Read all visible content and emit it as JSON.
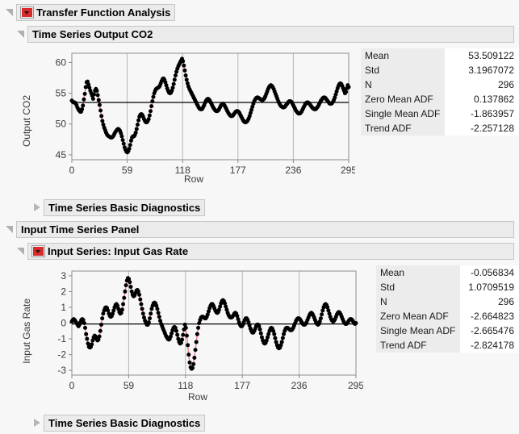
{
  "sections": {
    "root": {
      "title": "Transfer Function Analysis",
      "state": "expanded",
      "has_menu": true
    },
    "output_series": {
      "title": "Time Series Output CO2",
      "state": "expanded",
      "has_menu": false
    },
    "output_diagnostics": {
      "title": "Time Series Basic Diagnostics",
      "state": "collapsed",
      "has_menu": false
    },
    "input_panel": {
      "title": "Input Time Series Panel",
      "state": "expanded",
      "has_menu": false
    },
    "input_series": {
      "title": "Input Series: Input Gas Rate",
      "state": "expanded",
      "has_menu": true
    },
    "input_diagnostics": {
      "title": "Time Series Basic Diagnostics",
      "state": "collapsed",
      "has_menu": false
    }
  },
  "icons": {
    "open_triangle": "disclosure-open-triangle",
    "closed_triangle": "disclosure-closed-triangle",
    "red_menu": "red-triangle-menu-button"
  },
  "colors": {
    "marker": "#000000",
    "connector": "#f4808a",
    "mean_line": "#000000",
    "grid": "#b4b4b4",
    "frame": "#8c8c8c",
    "header_bg": "#ebebeb",
    "stats_key_bg": "#ececec",
    "red_button": "#d92b2b"
  },
  "stats_headers": [
    "Mean",
    "Std",
    "N",
    "Zero Mean ADF",
    "Single Mean ADF",
    "Trend ADF"
  ],
  "output_stats": [
    {
      "label": "Mean",
      "value": "53.509122"
    },
    {
      "label": "Std",
      "value": "3.1967072"
    },
    {
      "label": "N",
      "value": "296"
    },
    {
      "label": "Zero Mean ADF",
      "value": "0.137862"
    },
    {
      "label": "Single Mean ADF",
      "value": "-1.863957"
    },
    {
      "label": "Trend ADF",
      "value": "-2.257128"
    }
  ],
  "input_stats": [
    {
      "label": "Mean",
      "value": "-0.056834"
    },
    {
      "label": "Std",
      "value": "1.0709519"
    },
    {
      "label": "N",
      "value": "296"
    },
    {
      "label": "Zero Mean ADF",
      "value": "-2.664823"
    },
    {
      "label": "Single Mean ADF",
      "value": "-2.665476"
    },
    {
      "label": "Trend ADF",
      "value": "-2.824178"
    }
  ],
  "chart_data": [
    {
      "id": "output_co2",
      "type": "line",
      "title": "Time Series Output CO2",
      "xlabel": "Row",
      "ylabel": "Output CO2",
      "xlim": [
        0,
        295
      ],
      "ylim": [
        44.2,
        61.5
      ],
      "xticks": [
        0,
        59,
        118,
        177,
        236,
        295
      ],
      "yticks": [
        45,
        50,
        55,
        60
      ],
      "grid": "vertical-only",
      "mean_line": 53.509122,
      "n": 296,
      "markers": "filled-circle",
      "marker_color": "#000000",
      "line_color": "#f4808a",
      "values": [
        53.8,
        53.6,
        53.5,
        53.5,
        53.4,
        53.1,
        52.7,
        52.4,
        52.2,
        52.0,
        52.0,
        52.4,
        53.0,
        54.0,
        54.9,
        56.0,
        56.8,
        56.9,
        56.4,
        55.9,
        55.4,
        55.0,
        54.6,
        54.1,
        54.8,
        55.4,
        55.7,
        55.4,
        54.7,
        53.9,
        53.1,
        52.2,
        51.3,
        50.5,
        49.9,
        49.4,
        49.0,
        48.6,
        48.3,
        48.1,
        48.0,
        47.9,
        47.8,
        47.8,
        47.9,
        48.1,
        48.4,
        48.7,
        48.9,
        49.1,
        49.2,
        49.1,
        48.9,
        48.5,
        48.0,
        47.4,
        46.8,
        46.2,
        45.8,
        45.5,
        45.4,
        45.6,
        46.0,
        46.6,
        47.3,
        47.8,
        48.0,
        48.0,
        48.2,
        48.6,
        49.2,
        49.9,
        50.6,
        51.2,
        51.5,
        51.6,
        51.5,
        51.2,
        50.8,
        50.5,
        50.3,
        50.3,
        50.5,
        50.8,
        51.4,
        52.1,
        52.9,
        53.7,
        54.4,
        55.0,
        55.4,
        55.7,
        55.8,
        55.9,
        56.0,
        56.2,
        56.6,
        57.0,
        57.3,
        57.4,
        57.2,
        56.8,
        56.3,
        55.8,
        55.4,
        55.1,
        55.0,
        55.1,
        55.4,
        55.9,
        56.5,
        57.2,
        57.9,
        58.5,
        59.0,
        59.4,
        59.7,
        60.0,
        60.3,
        60.6,
        60.2,
        59.5,
        58.7,
        57.9,
        57.2,
        56.6,
        56.1,
        55.7,
        55.4,
        55.1,
        54.8,
        54.5,
        54.2,
        53.9,
        53.6,
        53.3,
        53.0,
        52.7,
        52.5,
        52.4,
        52.4,
        52.5,
        52.8,
        53.1,
        53.5,
        53.8,
        54.0,
        54.1,
        54.0,
        53.8,
        53.5,
        53.2,
        52.9,
        52.6,
        52.4,
        52.2,
        52.1,
        52.1,
        52.2,
        52.4,
        52.7,
        53.0,
        53.2,
        53.3,
        53.2,
        53.0,
        52.7,
        52.4,
        52.1,
        51.8,
        51.6,
        51.4,
        51.3,
        51.3,
        51.4,
        51.6,
        51.8,
        52.0,
        52.1,
        52.1,
        52.0,
        51.8,
        51.5,
        51.2,
        50.9,
        50.6,
        50.4,
        50.3,
        50.3,
        50.4,
        50.6,
        50.9,
        51.3,
        51.8,
        52.3,
        52.8,
        53.3,
        53.7,
        54.0,
        54.2,
        54.3,
        54.3,
        54.2,
        54.1,
        54.0,
        53.9,
        53.9,
        54.0,
        54.2,
        54.5,
        54.9,
        55.3,
        55.7,
        56.0,
        56.2,
        56.3,
        56.2,
        56.0,
        55.7,
        55.3,
        54.9,
        54.5,
        54.1,
        53.7,
        53.4,
        53.1,
        52.9,
        52.8,
        52.7,
        52.7,
        52.8,
        53.0,
        53.2,
        53.4,
        53.6,
        53.7,
        53.7,
        53.6,
        53.4,
        53.1,
        52.8,
        52.5,
        52.2,
        52.0,
        51.8,
        51.7,
        51.7,
        51.8,
        52.0,
        52.3,
        52.6,
        52.9,
        53.2,
        53.4,
        53.5,
        53.5,
        53.4,
        53.2,
        53.0,
        52.8,
        52.6,
        52.5,
        52.4,
        52.4,
        52.5,
        52.7,
        52.9,
        53.2,
        53.5,
        53.8,
        54.0,
        54.2,
        54.3,
        54.3,
        54.2,
        54.0,
        53.8,
        53.6,
        53.4,
        53.3,
        53.3,
        53.4,
        53.6,
        53.9,
        54.3,
        54.8,
        55.3,
        55.8,
        56.2,
        56.5,
        56.6,
        56.5,
        56.2,
        55.8,
        55.4,
        55.0,
        55.2,
        55.8,
        56.3,
        56.0
      ]
    },
    {
      "id": "input_gas_rate",
      "type": "line",
      "title": "Input Series: Input Gas Rate",
      "xlabel": "Row",
      "ylabel": "Input Gas Rate",
      "xlim": [
        0,
        295
      ],
      "ylim": [
        -3.3,
        3.3
      ],
      "xticks": [
        0,
        59,
        118,
        177,
        236,
        295
      ],
      "yticks": [
        -3,
        -2,
        -1,
        0,
        1,
        2,
        3
      ],
      "grid": "vertical-only",
      "mean_line": -0.056834,
      "n": 296,
      "markers": "filled-circle",
      "marker_color": "#000000",
      "line_color": "#f4808a",
      "values": [
        0.1,
        0.2,
        0.25,
        0.2,
        0.1,
        0.0,
        -0.1,
        -0.2,
        -0.1,
        0.05,
        0.2,
        0.25,
        0.2,
        0.0,
        -0.3,
        -0.7,
        -1.0,
        -1.3,
        -1.5,
        -1.55,
        -1.5,
        -1.35,
        -1.1,
        -0.9,
        -0.8,
        -0.85,
        -1.0,
        -1.1,
        -1.05,
        -0.85,
        -0.5,
        -0.1,
        0.3,
        0.6,
        0.8,
        0.95,
        1.0,
        0.95,
        0.8,
        0.6,
        0.45,
        0.4,
        0.45,
        0.6,
        0.8,
        1.0,
        1.15,
        1.2,
        1.1,
        0.9,
        0.7,
        0.6,
        0.65,
        0.85,
        1.2,
        1.6,
        2.0,
        2.4,
        2.7,
        2.85,
        2.8,
        2.6,
        2.3,
        2.0,
        1.8,
        1.7,
        1.75,
        1.9,
        2.05,
        2.1,
        2.0,
        1.8,
        1.5,
        1.2,
        0.9,
        0.6,
        0.35,
        0.15,
        0.0,
        -0.1,
        -0.1,
        0.05,
        0.3,
        0.6,
        0.9,
        1.1,
        1.25,
        1.3,
        1.25,
        1.1,
        0.9,
        0.65,
        0.4,
        0.15,
        -0.05,
        -0.2,
        -0.35,
        -0.5,
        -0.65,
        -0.8,
        -0.9,
        -1.0,
        -1.05,
        -1.0,
        -0.85,
        -0.65,
        -0.45,
        -0.3,
        -0.25,
        -0.3,
        -0.5,
        -0.75,
        -1.0,
        -1.2,
        -1.3,
        -1.25,
        -1.05,
        -0.75,
        -0.4,
        -0.1,
        -0.3,
        -0.8,
        -1.4,
        -2.0,
        -2.5,
        -2.8,
        -2.9,
        -2.85,
        -2.6,
        -2.2,
        -1.7,
        -1.2,
        -0.7,
        -0.3,
        0.0,
        0.2,
        0.35,
        0.4,
        0.4,
        0.35,
        0.3,
        0.3,
        0.4,
        0.55,
        0.75,
        0.95,
        1.1,
        1.2,
        1.2,
        1.1,
        0.95,
        0.8,
        0.7,
        0.65,
        0.7,
        0.85,
        1.05,
        1.25,
        1.4,
        1.45,
        1.4,
        1.25,
        1.05,
        0.85,
        0.65,
        0.5,
        0.4,
        0.35,
        0.35,
        0.4,
        0.5,
        0.6,
        0.65,
        0.6,
        0.45,
        0.25,
        0.05,
        -0.1,
        -0.2,
        -0.2,
        -0.1,
        0.05,
        0.2,
        0.3,
        0.3,
        0.2,
        0.05,
        -0.15,
        -0.35,
        -0.5,
        -0.6,
        -0.6,
        -0.5,
        -0.35,
        -0.2,
        -0.1,
        -0.1,
        -0.2,
        -0.4,
        -0.65,
        -0.9,
        -1.1,
        -1.25,
        -1.3,
        -1.25,
        -1.1,
        -0.9,
        -0.7,
        -0.5,
        -0.35,
        -0.3,
        -0.35,
        -0.5,
        -0.7,
        -0.95,
        -1.2,
        -1.4,
        -1.55,
        -1.6,
        -1.55,
        -1.4,
        -1.2,
        -0.95,
        -0.7,
        -0.5,
        -0.35,
        -0.3,
        -0.3,
        -0.35,
        -0.4,
        -0.45,
        -0.45,
        -0.4,
        -0.3,
        -0.15,
        0.0,
        0.15,
        0.25,
        0.3,
        0.3,
        0.25,
        0.15,
        0.05,
        -0.05,
        -0.1,
        -0.1,
        -0.05,
        0.05,
        0.2,
        0.35,
        0.5,
        0.6,
        0.65,
        0.6,
        0.5,
        0.35,
        0.2,
        0.05,
        -0.05,
        -0.1,
        -0.05,
        0.1,
        0.3,
        0.55,
        0.8,
        1.0,
        1.15,
        1.2,
        1.15,
        1.0,
        0.8,
        0.6,
        0.4,
        0.25,
        0.15,
        0.1,
        0.15,
        0.25,
        0.4,
        0.55,
        0.65,
        0.7,
        0.65,
        0.55,
        0.4,
        0.25,
        0.1,
        0.0,
        -0.05,
        -0.05,
        0.0,
        0.1,
        0.2,
        0.25,
        0.25,
        0.2,
        0.1,
        0.0,
        -0.05,
        0.0
      ]
    }
  ]
}
